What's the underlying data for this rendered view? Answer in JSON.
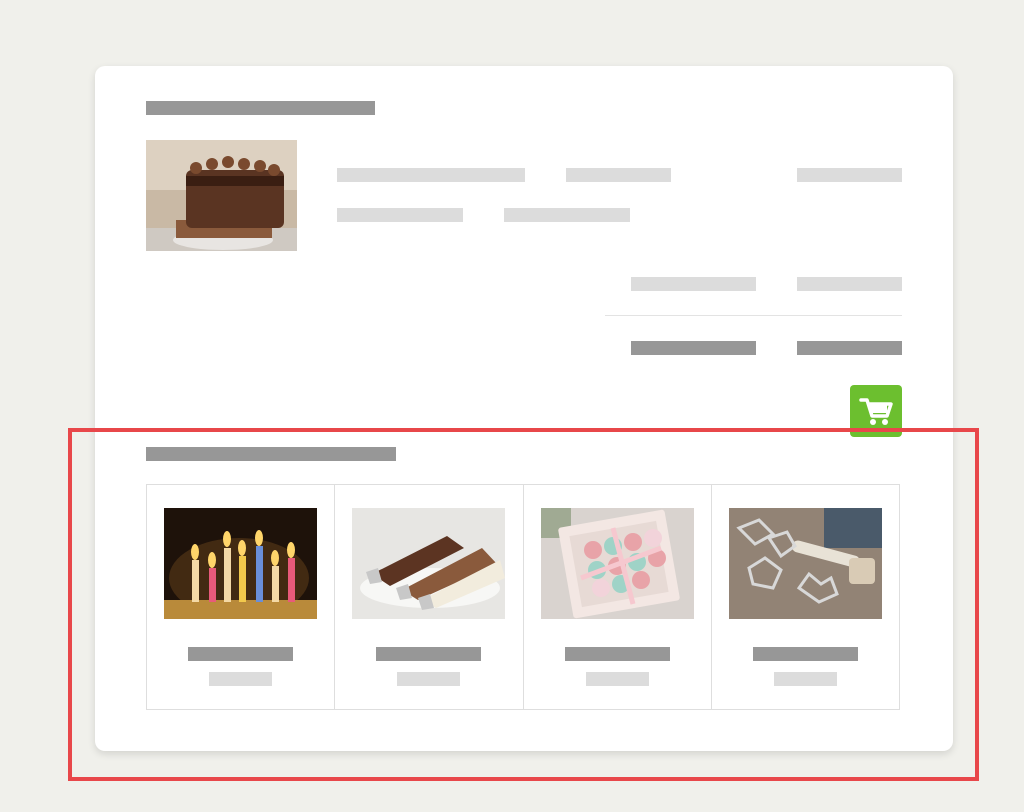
{
  "product": {
    "image": "chocolate-drip-cake-photo"
  },
  "cart_button": {
    "icon": "cart-icon",
    "color": "#6cbf2f"
  },
  "related_products": {
    "items": [
      {
        "image": "birthday-candles-photo"
      },
      {
        "image": "piping-bags-photo"
      },
      {
        "image": "macarons-box-photo"
      },
      {
        "image": "cookie-cutters-photo"
      }
    ]
  },
  "highlight": {
    "color": "#e8474a"
  }
}
